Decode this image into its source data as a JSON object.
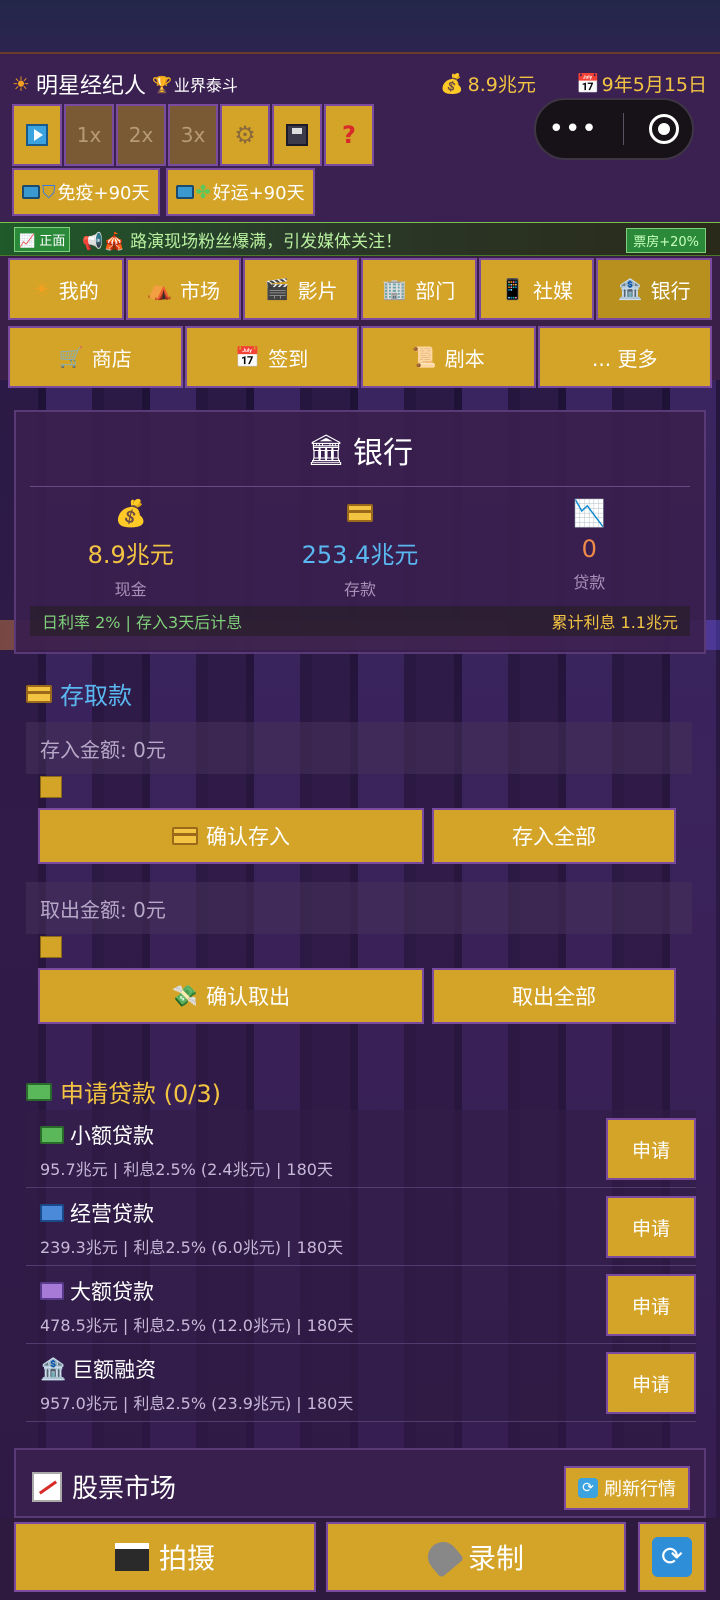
{
  "header": {
    "app_title": "明星经纪人",
    "rank": "业界泰斗",
    "money": "8.9兆元",
    "date": "9年5月15日",
    "speed_buttons": [
      "1x",
      "2x",
      "3x"
    ],
    "buffs": [
      {
        "label": "免疫+90天"
      },
      {
        "label": "好运+90天"
      }
    ]
  },
  "news": {
    "tag": "正面",
    "text": "路演现场粉丝爆满，引发媒体关注！",
    "badge": "票房+20%"
  },
  "nav": {
    "row1": [
      {
        "label": "我的",
        "icon": "sun-icon"
      },
      {
        "label": "市场",
        "icon": "tent-icon"
      },
      {
        "label": "影片",
        "icon": "clapper-icon"
      },
      {
        "label": "部门",
        "icon": "building-icon"
      },
      {
        "label": "社媒",
        "icon": "phone-icon"
      },
      {
        "label": "银行",
        "icon": "bank-icon"
      }
    ],
    "row2": [
      {
        "label": "商店",
        "icon": "cart-icon"
      },
      {
        "label": "签到",
        "icon": "calendar-icon"
      },
      {
        "label": "剧本",
        "icon": "scroll-icon"
      },
      {
        "label": "... 更多",
        "icon": ""
      }
    ]
  },
  "bank": {
    "title": "银行",
    "cash_value": "8.9兆元",
    "cash_label": "现金",
    "deposit_value": "253.4兆元",
    "deposit_label": "存款",
    "loan_value": "0",
    "loan_label": "贷款",
    "rate_text": "日利率 2% | 存入3天后计息",
    "interest_text": "累计利息 1.1兆元",
    "colors": {
      "cash": "#f3c442",
      "deposit": "#5ab8f0",
      "loan": "#f08a4a"
    }
  },
  "transfer": {
    "title": "存取款",
    "deposit_amount": "存入金额: 0元",
    "confirm_deposit": "确认存入",
    "deposit_all": "存入全部",
    "withdraw_amount": "取出金额: 0元",
    "confirm_withdraw": "确认取出",
    "withdraw_all": "取出全部"
  },
  "loans": {
    "title": "申请贷款 (0/3)",
    "items": [
      {
        "name": "小额贷款",
        "meta": "95.7兆元 | 利息2.5% (2.4兆元) | 180天",
        "button": "申请",
        "color": "#5ab85a"
      },
      {
        "name": "经营贷款",
        "meta": "239.3兆元 | 利息2.5% (6.0兆元) | 180天",
        "button": "申请",
        "color": "#4a8ad8"
      },
      {
        "name": "大额贷款",
        "meta": "478.5兆元 | 利息2.5% (12.0兆元) | 180天",
        "button": "申请",
        "color": "#a87ad8"
      },
      {
        "name": "巨额融资",
        "meta": "957.0兆元 | 利息2.5% (23.9兆元) | 180天",
        "button": "申请",
        "color": "#d8d8e8"
      }
    ]
  },
  "stock": {
    "title": "股票市场",
    "refresh": "刷新行情"
  },
  "bottom": {
    "shoot": "拍摄",
    "record": "录制"
  }
}
